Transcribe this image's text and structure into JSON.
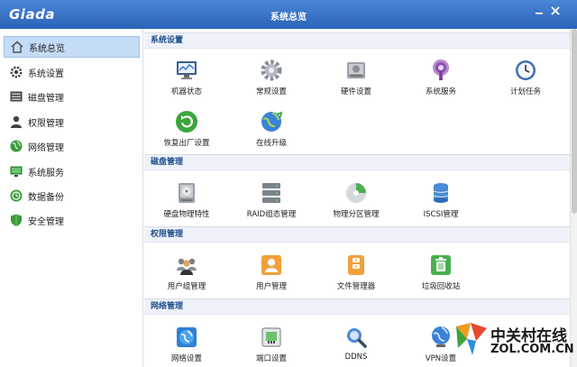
{
  "window": {
    "logo": "Giada",
    "title": "系统总览"
  },
  "sidebar": {
    "items": [
      {
        "label": "系统总览",
        "icon": "home-icon",
        "active": true
      },
      {
        "label": "系统设置",
        "icon": "gear-icon",
        "active": false
      },
      {
        "label": "磁盘管理",
        "icon": "disk-icon",
        "active": false
      },
      {
        "label": "权限管理",
        "icon": "user-icon",
        "active": false
      },
      {
        "label": "网络管理",
        "icon": "globe-icon",
        "active": false
      },
      {
        "label": "系统服务",
        "icon": "monitor-icon",
        "active": false
      },
      {
        "label": "数据备份",
        "icon": "backup-icon",
        "active": false
      },
      {
        "label": "安全管理",
        "icon": "shield-icon",
        "active": false
      }
    ]
  },
  "sections": [
    {
      "title": "系统设置",
      "tiles": [
        {
          "label": "机器状态",
          "icon": "monitor-chart-icon"
        },
        {
          "label": "常规设置",
          "icon": "gear-icon"
        },
        {
          "label": "硬件设置",
          "icon": "hardware-icon"
        },
        {
          "label": "系统服务",
          "icon": "podcast-icon"
        },
        {
          "label": "计划任务",
          "icon": "clock-icon"
        },
        {
          "label": "恢复出厂设置",
          "icon": "restore-icon"
        },
        {
          "label": "在线升级",
          "icon": "online-upgrade-icon"
        }
      ]
    },
    {
      "title": "磁盘管理",
      "tiles": [
        {
          "label": "硬盘物理特性",
          "icon": "hard-drive-icon"
        },
        {
          "label": "RAID组态管理",
          "icon": "raid-icon"
        },
        {
          "label": "物理分区管理",
          "icon": "partition-icon"
        },
        {
          "label": "ISCSI管理",
          "icon": "iscsi-icon"
        }
      ]
    },
    {
      "title": "权限管理",
      "tiles": [
        {
          "label": "用户组管理",
          "icon": "user-group-icon"
        },
        {
          "label": "用户管理",
          "icon": "user-card-icon"
        },
        {
          "label": "文件管理器",
          "icon": "file-manager-icon"
        },
        {
          "label": "垃圾回收站",
          "icon": "recycle-bin-icon"
        }
      ]
    },
    {
      "title": "网络管理",
      "tiles": [
        {
          "label": "网络设置",
          "icon": "network-globe-icon"
        },
        {
          "label": "端口设置",
          "icon": "port-icon"
        },
        {
          "label": "DDNS",
          "icon": "ddns-icon"
        },
        {
          "label": "VPN设置",
          "icon": "vpn-icon"
        }
      ]
    }
  ],
  "watermark": {
    "title": "中关村在线",
    "url": "ZOL.COM.CN"
  }
}
